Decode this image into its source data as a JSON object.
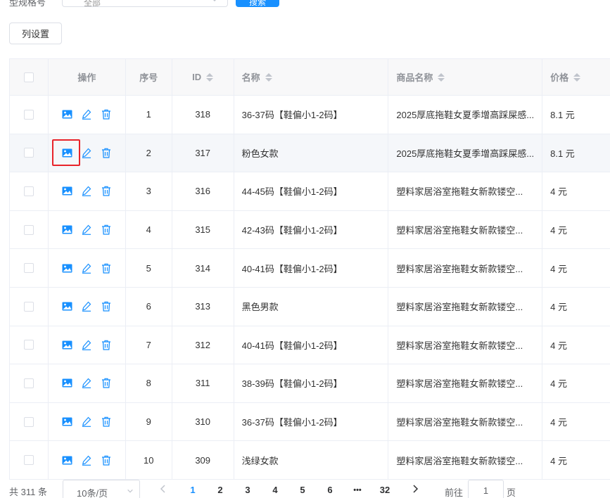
{
  "filter": {
    "label": "型规格号",
    "select_value": "全部",
    "search_button": "搜索"
  },
  "column_settings_button": "列设置",
  "table": {
    "headers": {
      "ops": "操作",
      "index": "序号",
      "id": "ID",
      "name": "名称",
      "product_name": "商品名称",
      "price": "价格"
    },
    "rows": [
      {
        "index": "1",
        "id": "318",
        "name": "36-37码【鞋偏小1-2码】",
        "product_name": "2025厚底拖鞋女夏季增高踩屎感...",
        "price": "8.1 元"
      },
      {
        "index": "2",
        "id": "317",
        "name": "粉色女款",
        "product_name": "2025厚底拖鞋女夏季增高踩屎感...",
        "price": "8.1 元"
      },
      {
        "index": "3",
        "id": "316",
        "name": "44-45码【鞋偏小1-2码】",
        "product_name": "塑料家居浴室拖鞋女新款镂空...",
        "price": "4 元"
      },
      {
        "index": "4",
        "id": "315",
        "name": "42-43码【鞋偏小1-2码】",
        "product_name": "塑料家居浴室拖鞋女新款镂空...",
        "price": "4 元"
      },
      {
        "index": "5",
        "id": "314",
        "name": "40-41码【鞋偏小1-2码】",
        "product_name": "塑料家居浴室拖鞋女新款镂空...",
        "price": "4 元"
      },
      {
        "index": "6",
        "id": "313",
        "name": "黑色男款",
        "product_name": "塑料家居浴室拖鞋女新款镂空...",
        "price": "4 元"
      },
      {
        "index": "7",
        "id": "312",
        "name": "40-41码【鞋偏小1-2码】",
        "product_name": "塑料家居浴室拖鞋女新款镂空...",
        "price": "4 元"
      },
      {
        "index": "8",
        "id": "311",
        "name": "38-39码【鞋偏小1-2码】",
        "product_name": "塑料家居浴室拖鞋女新款镂空...",
        "price": "4 元"
      },
      {
        "index": "9",
        "id": "310",
        "name": "36-37码【鞋偏小1-2码】",
        "product_name": "塑料家居浴室拖鞋女新款镂空...",
        "price": "4 元"
      },
      {
        "index": "10",
        "id": "309",
        "name": "浅绿女款",
        "product_name": "塑料家居浴室拖鞋女新款镂空...",
        "price": "4 元"
      }
    ]
  },
  "pagination": {
    "total": "共 311 条",
    "page_size": "10条/页",
    "pages": [
      "1",
      "2",
      "3",
      "4",
      "5",
      "6",
      "•••",
      "32"
    ],
    "current_page": "1",
    "goto_label": "前往",
    "goto_value": "1",
    "goto_unit": "页"
  },
  "colors": {
    "primary": "#1890ff",
    "icon": "#1890ff",
    "highlight": "#e8232a",
    "border": "#ebeef5"
  },
  "icons": {
    "row_actions": [
      "image-icon",
      "edit-icon",
      "delete-icon"
    ]
  }
}
